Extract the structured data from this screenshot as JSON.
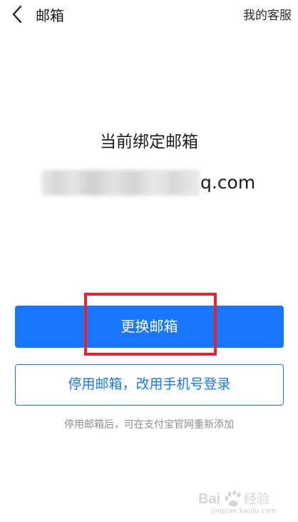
{
  "header": {
    "back_icon": "chevron-left-icon",
    "title": "邮箱",
    "service_label": "我的客服"
  },
  "main": {
    "current_label": "当前绑定邮箱",
    "email_visible_suffix": "q.com"
  },
  "actions": {
    "change_email_label": "更换邮箱",
    "disable_email_label": "停用邮箱，改用手机号登录",
    "hint": "停用邮箱后，可在支付宝官网重新添加"
  },
  "watermark": {
    "logo_text": "Bai 经验",
    "sub_text": "jingyan.baidu.com"
  },
  "colors": {
    "primary": "#1877fe",
    "highlight": "#e52430",
    "hint_text": "#8c8c8c"
  }
}
